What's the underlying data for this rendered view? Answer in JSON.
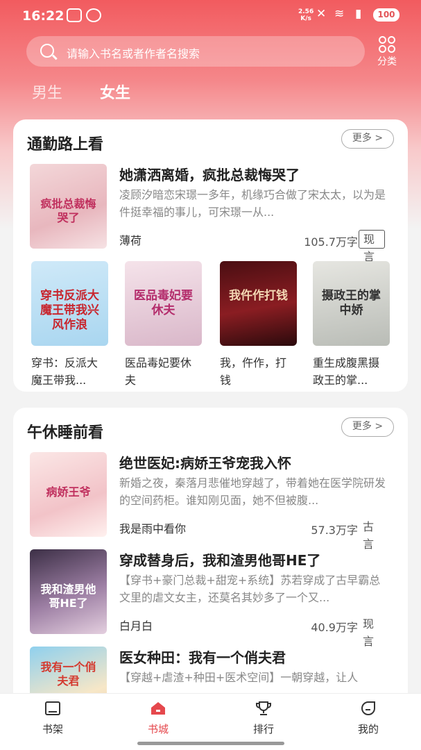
{
  "status_bar": {
    "time": "16:22",
    "net_speed": "2.56",
    "net_unit": "K/s",
    "battery": "100"
  },
  "search": {
    "placeholder": "请输入书名或者作者名搜索"
  },
  "category_label": "分类",
  "gender_tabs": {
    "male": "男生",
    "female": "女生",
    "selected": "女生"
  },
  "sections": [
    {
      "title": "通勤路上看",
      "more": "更多 >",
      "featured": {
        "title": "她潇洒离婚，疯批总裁悔哭了",
        "description": "凌顾汐暗恋宋璟一多年，机缘巧合做了宋太太，以为是件挺幸福的事儿，可宋璟一从...",
        "author": "薄荷",
        "word_count": "105.7万字",
        "tag": "现言",
        "cover_text": "疯批总裁悔哭了"
      },
      "grid": [
        {
          "title": "穿书：反派大魔王带我...",
          "cover_text": "穿书反派大魔王带我兴风作浪"
        },
        {
          "title": "医品毒妃要休夫",
          "cover_text": "医品毒妃要休夫"
        },
        {
          "title": "我，仵作，打钱",
          "cover_text": "我仵作打钱"
        },
        {
          "title": "重生成腹黑摄政王的掌...",
          "cover_text": "摄政王的掌中娇"
        }
      ]
    },
    {
      "title": "午休睡前看",
      "more": "更多 >",
      "list": [
        {
          "title": "绝世医妃:病娇王爷宠我入怀",
          "description": "新婚之夜，秦落月悲催地穿越了，带着她在医学院研发的空间药柜。谁知刚见面，她不但被腹...",
          "author": "我是雨中看你",
          "word_count": "57.3万字",
          "tag": "古言",
          "cover_text": "病娇王爷"
        },
        {
          "title": "穿成替身后，我和渣男他哥HE了",
          "description": "【穿书+豪门总裁+甜宠+系统】苏若穿成了古早霸总文里的虐文女主，还莫名其妙多了一个又...",
          "author": "白月白",
          "word_count": "40.9万字",
          "tag": "现言",
          "cover_text": "我和渣男他哥HE了"
        },
        {
          "title": "医女种田：我有一个俏夫君",
          "description": "【穿越+虐渣+种田+医术空间】一朝穿越，让人",
          "author": "",
          "word_count": "",
          "tag": "",
          "cover_text": "我有一个俏夫君"
        }
      ]
    }
  ],
  "bottom_nav": [
    {
      "label": "书架",
      "icon": "bookshelf-icon"
    },
    {
      "label": "书城",
      "icon": "bookstore-icon",
      "active": true
    },
    {
      "label": "排行",
      "icon": "trophy-icon"
    },
    {
      "label": "我的",
      "icon": "profile-icon"
    }
  ],
  "colors": {
    "accent": "#e5484d",
    "header_top": "#f25b5f"
  }
}
